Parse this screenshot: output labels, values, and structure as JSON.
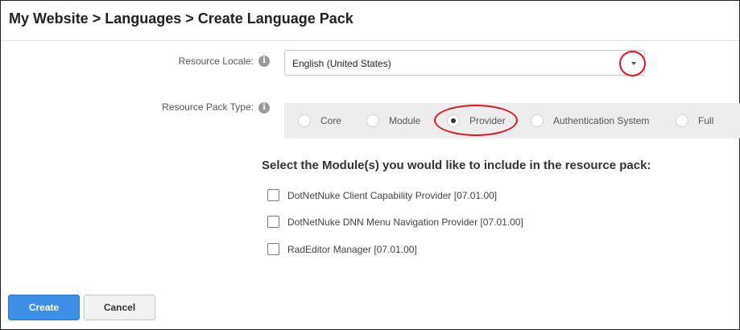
{
  "breadcrumb": {
    "title": "My Website > Languages > Create Language Pack"
  },
  "form": {
    "resource_locale": {
      "label": "Resource Locale:",
      "info_icon": "info-icon",
      "selected_value": "English (United States)",
      "caret_icon": "caret-down-icon"
    },
    "resource_pack_type": {
      "label": "Resource Pack Type:",
      "info_icon": "info-icon",
      "options": [
        {
          "label": "Core",
          "checked": false
        },
        {
          "label": "Module",
          "checked": false
        },
        {
          "label": "Provider",
          "checked": true
        },
        {
          "label": "Authentication System",
          "checked": false
        },
        {
          "label": "Full",
          "checked": false
        }
      ]
    },
    "modules": {
      "heading": "Select the Module(s) you would like to include in the resource pack:",
      "items": [
        {
          "label": "DotNetNuke Client Capability Provider [07.01.00]",
          "checked": false
        },
        {
          "label": "DotNetNuke DNN Menu Navigation Provider [07.01.00]",
          "checked": false
        },
        {
          "label": "RadEditor Manager [07.01.00]",
          "checked": false
        }
      ]
    }
  },
  "actions": {
    "create_label": "Create",
    "cancel_label": "Cancel"
  },
  "colors": {
    "primary_button": "#3d8fe6",
    "highlight_annotation": "#e1131b",
    "radio_panel_bg": "#ededed"
  }
}
